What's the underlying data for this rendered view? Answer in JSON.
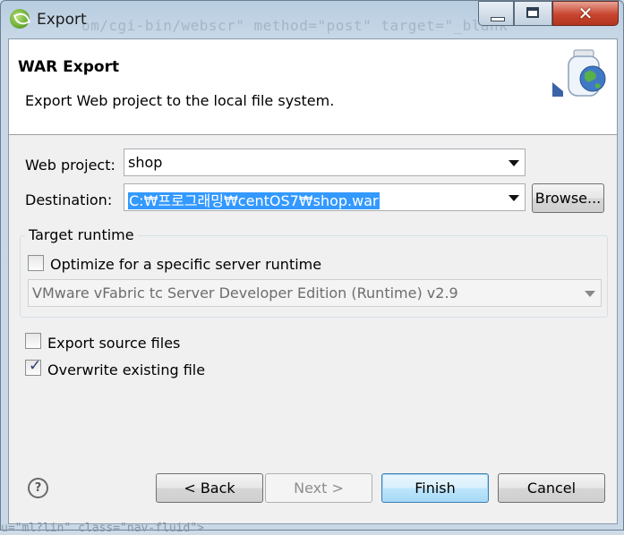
{
  "window": {
    "title": "Export",
    "background_code": "om/cgi-bin/webscr\" method=\"post\" target=\"_blank",
    "bottom_code": "u=\"ml?lin\"  class=\"nav-fluid\">"
  },
  "header": {
    "title": "WAR Export",
    "description": "Export Web project to the local file system."
  },
  "form": {
    "web_project": {
      "label": "Web project:",
      "value": "shop"
    },
    "destination": {
      "label": "Destination:",
      "value": "C:₩프로그래밍₩centOS7₩shop.war",
      "browse_label": "Browse..."
    }
  },
  "target_runtime": {
    "group_title": "Target runtime",
    "optimize_label": "Optimize for a specific server runtime",
    "optimize_checked": false,
    "runtime_value": "VMware vFabric tc Server Developer Edition (Runtime) v2.9"
  },
  "options": {
    "export_source_label": "Export source files",
    "export_source_checked": false,
    "overwrite_label": "Overwrite existing file",
    "overwrite_checked": true
  },
  "buttons": {
    "back": "< Back",
    "next": "Next >",
    "finish": "Finish",
    "cancel": "Cancel"
  },
  "icons": {
    "app": "eclipse-spring-icon",
    "help": "help-icon",
    "wizard": "jar-globe-icon",
    "check_glyph": "✓"
  },
  "colors": {
    "selection": "#3399ff",
    "default_button": "#a7d9f5",
    "close_button": "#c8442e"
  }
}
